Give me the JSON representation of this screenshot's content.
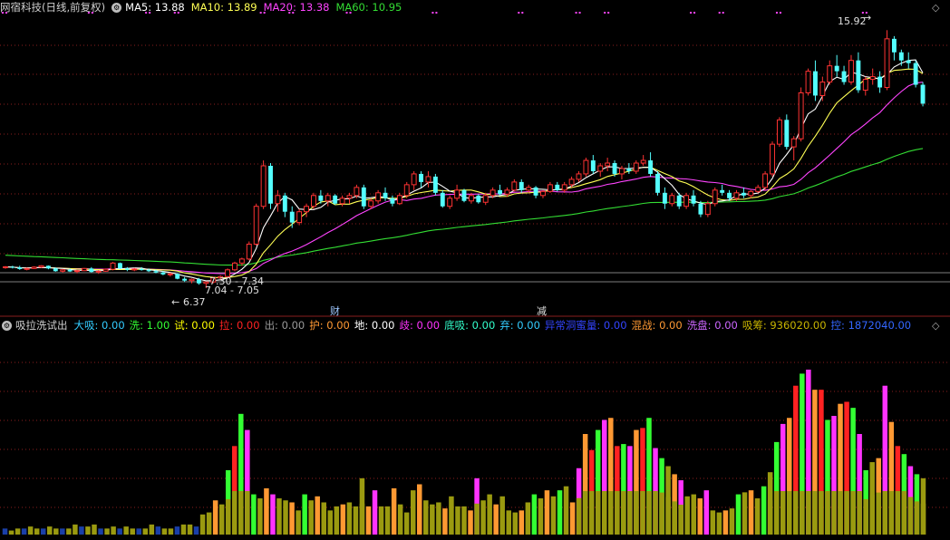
{
  "header": {
    "stock": "网宿科技(日线,前复权)",
    "ma": [
      {
        "label": "MA5:",
        "value": "13.88",
        "color": "#ffffff"
      },
      {
        "label": "MA10:",
        "value": "13.89",
        "color": "#ffff55"
      },
      {
        "label": "MA20:",
        "value": "13.38",
        "color": "#ff44ff"
      },
      {
        "label": "MA60:",
        "value": "10.95",
        "color": "#33dd33"
      }
    ]
  },
  "annotations": {
    "high": "15.92",
    "low": "6.37",
    "range1": "7.30 - 7.34",
    "range2": "7.04 - 7.05",
    "cai": "财",
    "jian": "减"
  },
  "indicator": {
    "name": "吸拉洗试出",
    "items": [
      {
        "label": "大吸:",
        "value": "0.00",
        "color": "#33ccff"
      },
      {
        "label": "洗:",
        "value": "1.00",
        "color": "#33ff33"
      },
      {
        "label": "试:",
        "value": "0.00",
        "color": "#ffff00"
      },
      {
        "label": "拉:",
        "value": "0.00",
        "color": "#ff2222"
      },
      {
        "label": "出:",
        "value": "0.00",
        "color": "#999999"
      },
      {
        "label": "护:",
        "value": "0.00",
        "color": "#ff9933"
      },
      {
        "label": "地:",
        "value": "0.00",
        "color": "#ffffff"
      },
      {
        "label": "歧:",
        "value": "0.00",
        "color": "#ff33ff"
      },
      {
        "label": "底吸:",
        "value": "0.00",
        "color": "#33ffcc"
      },
      {
        "label": "弃:",
        "value": "0.00",
        "color": "#33ccff"
      },
      {
        "label": "异常洞蜜量:",
        "value": "0.00",
        "color": "#3344ff"
      },
      {
        "label": "混战:",
        "value": "0.00",
        "color": "#ff9933"
      },
      {
        "label": "洗盘:",
        "value": "0.00",
        "color": "#cc66ff"
      },
      {
        "label": "吸筹:",
        "value": "936020.00",
        "color": "#c8b400"
      },
      {
        "label": "控:",
        "value": "1872040.00",
        "color": "#3366ff"
      }
    ]
  },
  "colors": {
    "up": "#ff3333",
    "down": "#54ffff",
    "ma5": "#ffffff",
    "ma10": "#ffff55",
    "ma20": "#ff44ff",
    "ma60": "#33dd33",
    "grid": "#8a1e1e",
    "vol_base": "#9a9a10"
  },
  "chart_data": {
    "type": "candlestick",
    "price_range": [
      5.4,
      16.5
    ],
    "candles": [
      [
        7.13,
        7.19,
        7.09,
        7.16
      ],
      [
        7.16,
        7.2,
        7.1,
        7.14
      ],
      [
        7.14,
        7.2,
        7.05,
        7.08
      ],
      [
        7.08,
        7.13,
        7.03,
        7.1
      ],
      [
        7.1,
        7.18,
        7.08,
        7.15
      ],
      [
        7.15,
        7.22,
        7.12,
        7.2
      ],
      [
        7.2,
        7.21,
        7.07,
        7.1
      ],
      [
        7.1,
        7.14,
        6.98,
        7.0
      ],
      [
        7.0,
        7.08,
        6.95,
        7.05
      ],
      [
        7.05,
        7.1,
        6.97,
        6.99
      ],
      [
        6.99,
        7.05,
        6.92,
        7.02
      ],
      [
        7.02,
        7.12,
        7.0,
        7.1
      ],
      [
        7.1,
        7.15,
        6.95,
        6.97
      ],
      [
        6.97,
        7.03,
        6.9,
        7.0
      ],
      [
        7.0,
        7.1,
        6.98,
        7.07
      ],
      [
        7.07,
        7.34,
        7.03,
        7.3
      ],
      [
        7.3,
        7.32,
        7.08,
        7.1
      ],
      [
        7.1,
        7.15,
        7.0,
        7.05
      ],
      [
        7.05,
        7.12,
        7.0,
        7.08
      ],
      [
        7.08,
        7.15,
        7.02,
        7.04
      ],
      [
        7.04,
        7.1,
        6.97,
        7.0
      ],
      [
        7.0,
        7.06,
        6.92,
        6.95
      ],
      [
        6.95,
        7.0,
        6.85,
        6.88
      ],
      [
        6.88,
        6.95,
        6.8,
        6.9
      ],
      [
        6.9,
        6.92,
        6.7,
        6.72
      ],
      [
        6.72,
        6.78,
        6.6,
        6.65
      ],
      [
        6.65,
        6.73,
        6.55,
        6.7
      ],
      [
        6.7,
        6.75,
        6.5,
        6.55
      ],
      [
        6.55,
        6.62,
        6.37,
        6.6
      ],
      [
        6.6,
        6.8,
        6.55,
        6.75
      ],
      [
        6.75,
        6.85,
        6.7,
        6.8
      ],
      [
        6.8,
        7.1,
        6.75,
        7.05
      ],
      [
        7.05,
        7.35,
        7.0,
        7.3
      ],
      [
        7.3,
        7.5,
        7.2,
        7.45
      ],
      [
        7.45,
        8.1,
        7.4,
        8.0
      ],
      [
        8.0,
        9.5,
        7.95,
        9.4
      ],
      [
        9.4,
        11.1,
        9.3,
        10.9
      ],
      [
        10.9,
        11.0,
        9.3,
        9.5
      ],
      [
        9.5,
        10.0,
        9.2,
        9.8
      ],
      [
        9.8,
        9.9,
        9.0,
        9.2
      ],
      [
        9.2,
        9.4,
        8.6,
        8.8
      ],
      [
        8.8,
        9.3,
        8.7,
        9.2
      ],
      [
        9.2,
        9.5,
        9.0,
        9.4
      ],
      [
        9.4,
        9.9,
        9.3,
        9.8
      ],
      [
        9.8,
        10.0,
        9.5,
        9.6
      ],
      [
        9.6,
        9.9,
        9.4,
        9.8
      ],
      [
        9.8,
        9.85,
        9.45,
        9.5
      ],
      [
        9.5,
        9.8,
        9.4,
        9.7
      ],
      [
        9.7,
        9.9,
        9.5,
        9.8
      ],
      [
        9.8,
        10.2,
        9.7,
        10.1
      ],
      [
        10.1,
        10.2,
        9.3,
        9.4
      ],
      [
        9.4,
        9.7,
        9.3,
        9.6
      ],
      [
        9.6,
        10.0,
        9.5,
        9.9
      ],
      [
        9.9,
        10.1,
        9.6,
        9.7
      ],
      [
        9.7,
        9.8,
        9.4,
        9.5
      ],
      [
        9.5,
        9.9,
        9.45,
        9.8
      ],
      [
        9.8,
        10.3,
        9.7,
        10.2
      ],
      [
        10.2,
        10.7,
        10.0,
        10.6
      ],
      [
        10.6,
        10.7,
        10.1,
        10.3
      ],
      [
        10.3,
        10.7,
        10.1,
        10.5
      ],
      [
        10.5,
        10.6,
        9.8,
        9.9
      ],
      [
        9.9,
        10.0,
        9.35,
        9.4
      ],
      [
        9.4,
        9.8,
        9.3,
        9.7
      ],
      [
        9.7,
        10.2,
        9.6,
        10.0
      ],
      [
        10.0,
        10.05,
        9.55,
        9.6
      ],
      [
        9.6,
        9.9,
        9.5,
        9.8
      ],
      [
        9.8,
        9.85,
        9.5,
        9.55
      ],
      [
        9.55,
        9.9,
        9.45,
        9.8
      ],
      [
        9.8,
        10.1,
        9.7,
        10.0
      ],
      [
        10.0,
        10.2,
        9.8,
        9.85
      ],
      [
        9.85,
        10.1,
        9.75,
        10.0
      ],
      [
        10.0,
        10.4,
        9.95,
        10.3
      ],
      [
        10.3,
        10.4,
        9.9,
        10.0
      ],
      [
        10.0,
        10.2,
        9.9,
        10.1
      ],
      [
        10.1,
        10.15,
        9.7,
        9.8
      ],
      [
        9.8,
        10.0,
        9.7,
        9.95
      ],
      [
        9.95,
        10.3,
        9.9,
        10.2
      ],
      [
        10.2,
        10.3,
        9.95,
        10.0
      ],
      [
        10.0,
        10.3,
        9.9,
        10.2
      ],
      [
        10.2,
        10.5,
        10.1,
        10.4
      ],
      [
        10.4,
        10.7,
        10.3,
        10.6
      ],
      [
        10.6,
        11.2,
        10.5,
        11.1
      ],
      [
        11.1,
        11.3,
        10.6,
        10.7
      ],
      [
        10.7,
        11.0,
        10.5,
        10.9
      ],
      [
        10.9,
        11.2,
        10.7,
        11.0
      ],
      [
        11.0,
        11.1,
        10.5,
        10.6
      ],
      [
        10.6,
        10.9,
        10.4,
        10.8
      ],
      [
        10.8,
        11.0,
        10.6,
        10.7
      ],
      [
        10.7,
        11.1,
        10.6,
        11.0
      ],
      [
        11.0,
        11.3,
        10.9,
        11.1
      ],
      [
        11.1,
        11.4,
        10.5,
        10.6
      ],
      [
        10.6,
        10.7,
        9.8,
        9.9
      ],
      [
        9.9,
        10.1,
        9.3,
        9.5
      ],
      [
        9.5,
        9.9,
        9.4,
        9.8
      ],
      [
        9.8,
        9.9,
        9.3,
        9.4
      ],
      [
        9.4,
        9.9,
        9.3,
        9.8
      ],
      [
        9.8,
        10.0,
        9.4,
        9.5
      ],
      [
        9.5,
        9.6,
        9.0,
        9.1
      ],
      [
        9.1,
        9.6,
        9.0,
        9.5
      ],
      [
        9.5,
        10.1,
        9.4,
        10.0
      ],
      [
        10.0,
        10.2,
        9.8,
        9.9
      ],
      [
        9.9,
        10.0,
        9.6,
        9.7
      ],
      [
        9.7,
        10.0,
        9.6,
        9.9
      ],
      [
        9.9,
        10.1,
        9.7,
        9.8
      ],
      [
        9.8,
        10.0,
        9.7,
        9.95
      ],
      [
        9.95,
        10.2,
        9.9,
        10.1
      ],
      [
        10.1,
        10.7,
        10.0,
        10.6
      ],
      [
        10.6,
        11.8,
        10.5,
        11.7
      ],
      [
        11.7,
        12.7,
        11.6,
        12.6
      ],
      [
        12.6,
        12.8,
        11.5,
        11.6
      ],
      [
        11.6,
        12.0,
        11.1,
        11.9
      ],
      [
        11.9,
        13.8,
        11.8,
        13.6
      ],
      [
        13.6,
        14.5,
        13.5,
        14.4
      ],
      [
        14.4,
        14.8,
        13.3,
        13.5
      ],
      [
        13.5,
        14.2,
        13.3,
        14.0
      ],
      [
        14.0,
        14.8,
        13.9,
        14.6
      ],
      [
        14.6,
        15.0,
        14.2,
        14.4
      ],
      [
        14.4,
        14.6,
        13.9,
        14.0
      ],
      [
        14.0,
        15.0,
        13.9,
        14.8
      ],
      [
        14.8,
        15.1,
        13.6,
        13.7
      ],
      [
        13.7,
        14.2,
        13.5,
        14.1
      ],
      [
        14.1,
        14.5,
        13.9,
        14.2
      ],
      [
        14.2,
        14.4,
        13.6,
        13.8
      ],
      [
        13.8,
        15.92,
        13.7,
        15.6
      ],
      [
        15.6,
        15.7,
        14.8,
        15.1
      ],
      [
        15.1,
        15.2,
        14.6,
        14.8
      ],
      [
        14.8,
        15.1,
        14.5,
        14.7
      ],
      [
        14.7,
        14.8,
        13.8,
        13.9
      ],
      [
        13.9,
        14.0,
        13.1,
        13.2
      ]
    ],
    "volume_levels": [
      3,
      2,
      3,
      3,
      4,
      3,
      3,
      4,
      3,
      3,
      3,
      5,
      4,
      4,
      5,
      3,
      3,
      4,
      3,
      4,
      3,
      3,
      3,
      5,
      4,
      3,
      3,
      4,
      5,
      5,
      4,
      10,
      11,
      17,
      15,
      32,
      44,
      60,
      52,
      20,
      18,
      23,
      20,
      18,
      17,
      16,
      12,
      20,
      17,
      19,
      16,
      12,
      14,
      15,
      16,
      14,
      28,
      14,
      22,
      14,
      14,
      23,
      15,
      11,
      22,
      25,
      17,
      15,
      16,
      13,
      19,
      14,
      14,
      12,
      28,
      17,
      20,
      15,
      19,
      12,
      11,
      12,
      16,
      20,
      18,
      22,
      19,
      22,
      24,
      16,
      33,
      50,
      42,
      52,
      57,
      58,
      44,
      45,
      44,
      52,
      53,
      58,
      43,
      38,
      34,
      30,
      27,
      19,
      20,
      18,
      22,
      12,
      11,
      12,
      13,
      20,
      21,
      22,
      18,
      24,
      31,
      46,
      55,
      58,
      74,
      80,
      82,
      72,
      72,
      57,
      59,
      65,
      66,
      63,
      50,
      32,
      36,
      38,
      74,
      56,
      44,
      40,
      34,
      30,
      28
    ],
    "volume_max": 100
  }
}
